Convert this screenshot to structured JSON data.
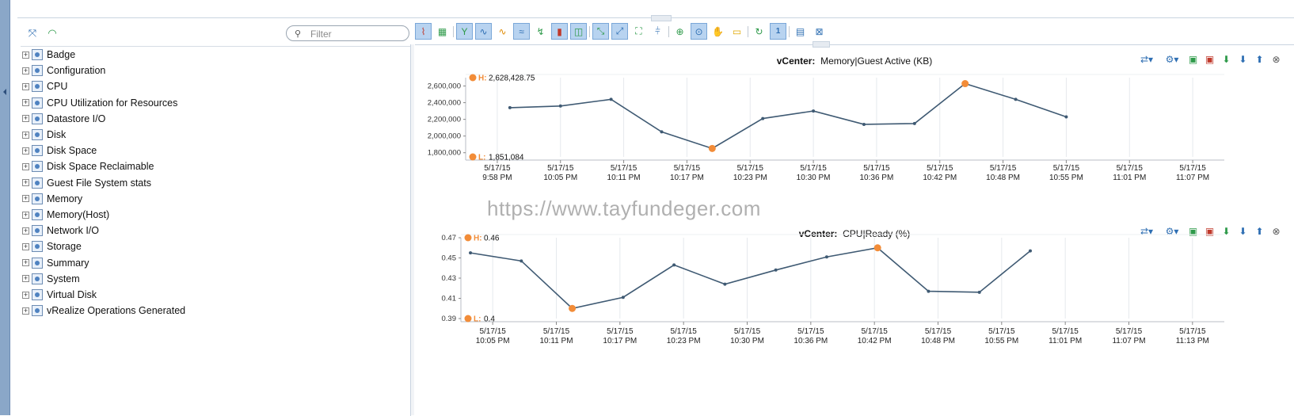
{
  "tree": {
    "filter_placeholder": "Filter",
    "items": [
      {
        "label": "Badge"
      },
      {
        "label": "Configuration"
      },
      {
        "label": "CPU"
      },
      {
        "label": "CPU Utilization for Resources"
      },
      {
        "label": "Datastore I/O"
      },
      {
        "label": "Disk"
      },
      {
        "label": "Disk Space"
      },
      {
        "label": "Disk Space Reclaimable"
      },
      {
        "label": "Guest File System stats"
      },
      {
        "label": "Memory"
      },
      {
        "label": "Memory(Host)"
      },
      {
        "label": "Network I/O"
      },
      {
        "label": "Storage"
      },
      {
        "label": "Summary"
      },
      {
        "label": "System"
      },
      {
        "label": "Virtual Disk"
      },
      {
        "label": "vRealize Operations Generated"
      }
    ]
  },
  "watermark": "https://www.tayfundeger.com",
  "colors": {
    "line": "#3f5a73",
    "marker": "#f28c38",
    "grid": "#e6e9ed",
    "selected": "#b8d3f0"
  },
  "chart_data": [
    {
      "type": "line",
      "title_prefix": "vCenter:",
      "title": "Memory|Guest Active (KB)",
      "high_label": "H:",
      "high_value": "2,628,428.75",
      "low_label": "L:",
      "low_value": "1,851,084",
      "ylim": [
        1750000,
        2700000
      ],
      "yticks": [
        1800000,
        2000000,
        2200000,
        2400000,
        2600000
      ],
      "ytick_labels": [
        "1,800,000",
        "2,000,000",
        "2,200,000",
        "2,400,000",
        "2,600,000"
      ],
      "xticks": [
        {
          "date": "5/17/15",
          "time": "9:58 PM"
        },
        {
          "date": "5/17/15",
          "time": "10:05 PM"
        },
        {
          "date": "5/17/15",
          "time": "10:11 PM"
        },
        {
          "date": "5/17/15",
          "time": "10:17 PM"
        },
        {
          "date": "5/17/15",
          "time": "10:23 PM"
        },
        {
          "date": "5/17/15",
          "time": "10:30 PM"
        },
        {
          "date": "5/17/15",
          "time": "10:36 PM"
        },
        {
          "date": "5/17/15",
          "time": "10:42 PM"
        },
        {
          "date": "5/17/15",
          "time": "10:48 PM"
        },
        {
          "date": "5/17/15",
          "time": "10:55 PM"
        },
        {
          "date": "5/17/15",
          "time": "11:01 PM"
        },
        {
          "date": "5/17/15",
          "time": "11:07 PM"
        }
      ],
      "xlim": [
        0,
        12
      ],
      "x": [
        0.7,
        1.5,
        2.3,
        3.1,
        3.9,
        4.7,
        5.5,
        6.3,
        7.1,
        7.9,
        8.7,
        9.5
      ],
      "values": [
        2340000,
        2360000,
        2440000,
        2050000,
        1851084,
        2210000,
        2300000,
        2140000,
        2150000,
        2628428.75,
        2440000,
        2230000
      ],
      "high_index": 9,
      "low_index": 4
    },
    {
      "type": "line",
      "title_prefix": "vCenter:",
      "title": "CPU|Ready (%)",
      "high_label": "H:",
      "high_value": "0.46",
      "low_label": "L:",
      "low_value": "0.4",
      "ylim": [
        0.39,
        0.47
      ],
      "yticks": [
        0.39,
        0.41,
        0.43,
        0.45,
        0.47
      ],
      "ytick_labels": [
        "0.39",
        "0.41",
        "0.43",
        "0.45",
        "0.47"
      ],
      "xticks": [
        {
          "date": "5/17/15",
          "time": "10:05 PM"
        },
        {
          "date": "5/17/15",
          "time": "10:11 PM"
        },
        {
          "date": "5/17/15",
          "time": "10:17 PM"
        },
        {
          "date": "5/17/15",
          "time": "10:23 PM"
        },
        {
          "date": "5/17/15",
          "time": "10:30 PM"
        },
        {
          "date": "5/17/15",
          "time": "10:36 PM"
        },
        {
          "date": "5/17/15",
          "time": "10:42 PM"
        },
        {
          "date": "5/17/15",
          "time": "10:48 PM"
        },
        {
          "date": "5/17/15",
          "time": "10:55 PM"
        },
        {
          "date": "5/17/15",
          "time": "11:01 PM"
        },
        {
          "date": "5/17/15",
          "time": "11:07 PM"
        },
        {
          "date": "5/17/15",
          "time": "11:13 PM"
        }
      ],
      "xlim": [
        0,
        12
      ],
      "x": [
        0.15,
        0.95,
        1.75,
        2.55,
        3.35,
        4.15,
        4.95,
        5.75,
        6.55,
        7.35,
        8.15,
        8.95
      ],
      "values": [
        0.455,
        0.447,
        0.4,
        0.411,
        0.443,
        0.424,
        0.438,
        0.451,
        0.46,
        0.417,
        0.416,
        0.457
      ],
      "high_index": 8,
      "low_index": 2
    }
  ]
}
